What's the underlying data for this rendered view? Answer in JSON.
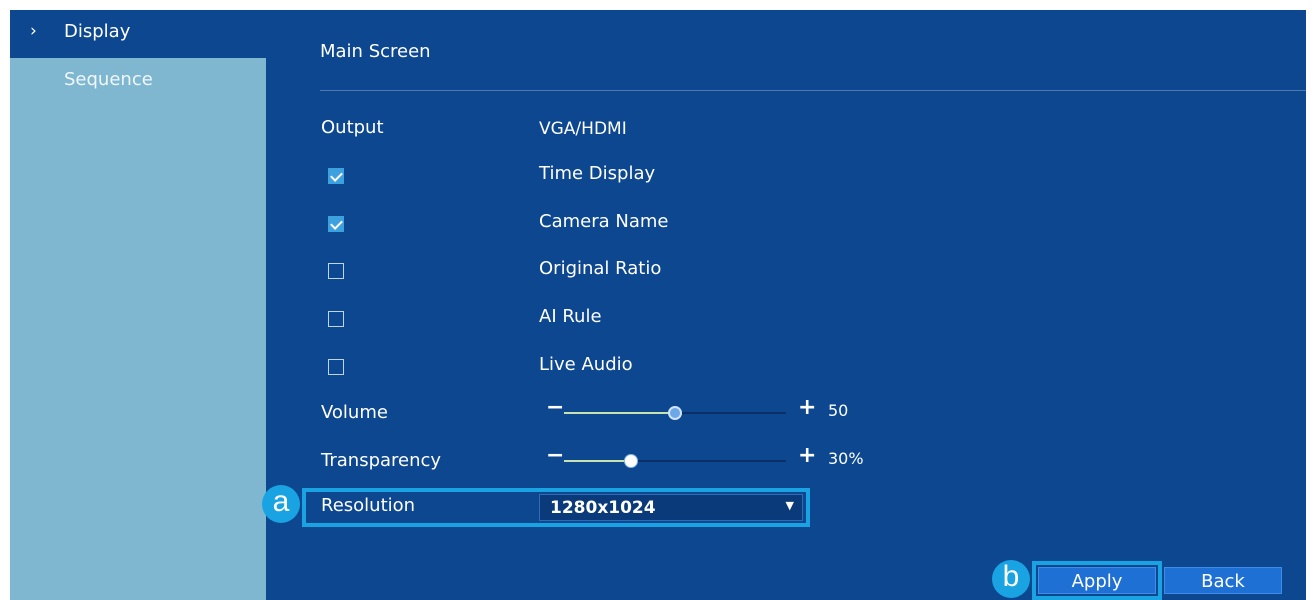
{
  "sidebar": {
    "chevron": "›",
    "items": [
      {
        "label": "Display",
        "active": true
      },
      {
        "label": "Sequence",
        "active": false
      }
    ]
  },
  "main": {
    "title": "Main Screen",
    "output": {
      "label": "Output",
      "value": "VGA/HDMI"
    },
    "checkboxes": [
      {
        "label": "Time Display",
        "checked": true
      },
      {
        "label": "Camera Name",
        "checked": true
      },
      {
        "label": "Original Ratio",
        "checked": false
      },
      {
        "label": "AI Rule",
        "checked": false
      },
      {
        "label": "Live Audio",
        "checked": false
      }
    ],
    "volume": {
      "label": "Volume",
      "minus": "−",
      "plus": "+",
      "value_text": "50",
      "fraction": 0.5
    },
    "transparency": {
      "label": "Transparency",
      "minus": "−",
      "plus": "+",
      "value_text": "30%",
      "fraction": 0.3
    },
    "resolution": {
      "label": "Resolution",
      "value": "1280x1024",
      "caret": "▼"
    }
  },
  "markers": {
    "a": "a",
    "b": "b"
  },
  "buttons": {
    "apply": "Apply",
    "back": "Back"
  },
  "colors": {
    "panel_bg": "#0c4790",
    "sidebar_bg": "#7fb7d1",
    "highlight": "#1aa3e2",
    "button_bg": "#1f70d4",
    "checkbox_checked": "#3da1e0"
  }
}
